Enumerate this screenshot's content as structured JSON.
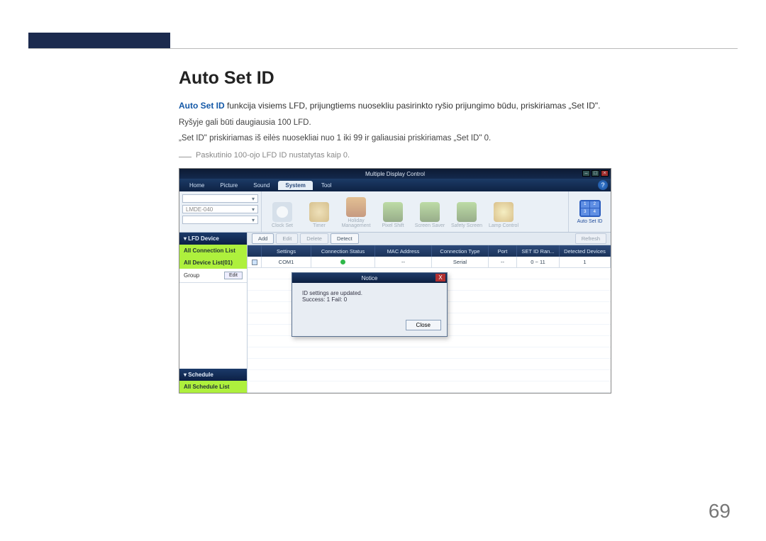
{
  "page": {
    "title": "Auto Set ID",
    "lead_emph": "Auto Set ID",
    "lead_rest": " funkcija visiems LFD, prijungtiems nuosekliu pasirinkto ryšio prijungimo būdu, priskiriamas „Set ID\".",
    "line2": "Ryšyje gali būti daugiausia 100 LFD.",
    "line3": "„Set ID\" priskiriamas iš eilės nuosekliai nuo 1 iki 99 ir galiausiai priskiriamas „Set ID\" 0.",
    "note": "Paskutinio 100-ojo LFD ID nustatytas kaip 0.",
    "number": "69"
  },
  "app": {
    "window_title": "Multiple Display Control",
    "menu": {
      "home": "Home",
      "picture": "Picture",
      "sound": "Sound",
      "system": "System",
      "tool": "Tool"
    },
    "help": "?",
    "devsel": {
      "a": "",
      "b": "LMDE-040"
    },
    "ribbon_tools": {
      "t1": "Clock Set",
      "t2": "Timer",
      "t3": "Holiday Management",
      "t4": "Pixel Shift",
      "t5": "Screen Saver",
      "t6": "Safety Screen",
      "t7": "Lamp Control"
    },
    "autoset": {
      "cells": [
        "1",
        "2",
        "3",
        "4"
      ],
      "label": "Auto Set ID"
    },
    "sidebar": {
      "hdr1": "LFD Device",
      "all_conn": "All Connection List",
      "all_dev": "All Device List(01)",
      "group": "Group",
      "edit": "Edit",
      "hdr2": "Schedule",
      "all_sched": "All Schedule List"
    },
    "toolbar": {
      "add": "Add",
      "edit": "Edit",
      "delete": "Delete",
      "detect": "Detect",
      "refresh": "Refresh"
    },
    "thead": {
      "c1": "",
      "c2": "Settings",
      "c3": "Connection Status",
      "c4": "MAC Address",
      "c5": "Connection Type",
      "c6": "Port",
      "c7": "SET ID Ran...",
      "c8": "Detected Devices"
    },
    "row": {
      "settings": "COM1",
      "mac": "--",
      "ctype": "Serial",
      "port": "--",
      "range": "0 ~ 11",
      "detected": "1"
    },
    "dialog": {
      "title": "Notice",
      "line1": "ID settings are updated.",
      "line2": "Success: 1  Fail: 0",
      "close": "Close"
    }
  }
}
